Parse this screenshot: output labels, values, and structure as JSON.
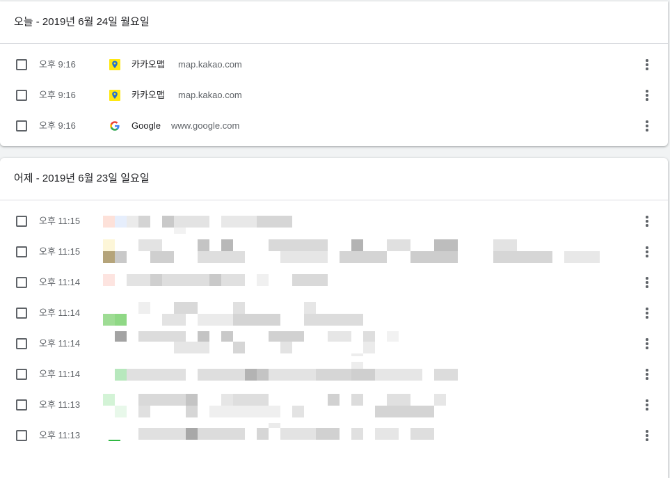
{
  "sections": [
    {
      "title": "오늘 - 2019년 6월 24일 월요일",
      "items": [
        {
          "time": "오후 9:16",
          "favicon": "kakao-map-icon",
          "title": "카카오맵",
          "domain": "map.kakao.com"
        },
        {
          "time": "오후 9:16",
          "favicon": "kakao-map-icon",
          "title": "카카오맵",
          "domain": "map.kakao.com"
        },
        {
          "time": "오후 9:16",
          "favicon": "google-icon",
          "title": "Google",
          "domain": "www.google.com"
        }
      ]
    },
    {
      "title": "어제 - 2019년 6월 23일 일요일",
      "items": [
        {
          "time": "오후 11:15"
        },
        {
          "time": "오후 11:15"
        },
        {
          "time": "오후 11:14"
        },
        {
          "time": "오후 11:14"
        },
        {
          "time": "오후 11:14"
        },
        {
          "time": "오후 11:14"
        },
        {
          "time": "오후 11:13"
        },
        {
          "time": "오후 11:13"
        }
      ]
    }
  ],
  "colors": {
    "background": "#f1f3f4",
    "card": "#ffffff",
    "divider": "#dadce0",
    "secondary_text": "#5f6368",
    "kakao_yellow": "#ffe812",
    "kakao_pin": "#1f6fd1"
  }
}
